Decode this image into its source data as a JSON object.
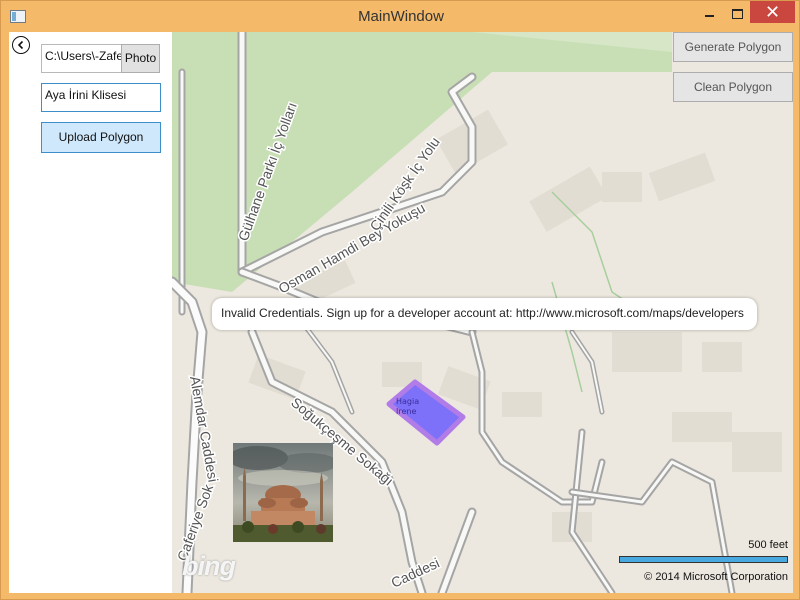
{
  "window": {
    "title": "MainWindow",
    "close_glyph": "✕"
  },
  "left_panel": {
    "path_value": "C:\\Users\\-Zafe",
    "photo_button": "Photo",
    "name_value": "Aya İrini Klisesi",
    "upload_button": "Upload Polygon"
  },
  "map": {
    "generate_button": "Generate Polygon",
    "clean_button": "Clean Polygon",
    "error_message": "Invalid Credentials. Sign up for a developer account at: http://www.microsoft.com/maps/developers",
    "polygon_label_line1": "Hagia",
    "polygon_label_line2": "Irene",
    "street_labels": {
      "gulhane": "Gülhane Parkı İç Yolları",
      "osman": "Osman Hamdi Bey Yokuşu",
      "cinili": "Çinili Köşk İç Yolu",
      "alemdar": "Alemdar Caddesi",
      "sogukcesme": "Soğukçeşme Sokağı",
      "caferiye": "Caferiye Sok",
      "caddesi": "Caddesi"
    },
    "logo_text": "bing",
    "scale_label": "500 feet",
    "copyright": "© 2014 Microsoft Corporation"
  },
  "colors": {
    "frame": "#f5b96a",
    "accent": "#3d8ec9",
    "park": "#c8dfb5",
    "polygon_fill": "#6a5cff",
    "polygon_stroke": "#b27ce8",
    "scale_bar": "#49a8e0"
  }
}
